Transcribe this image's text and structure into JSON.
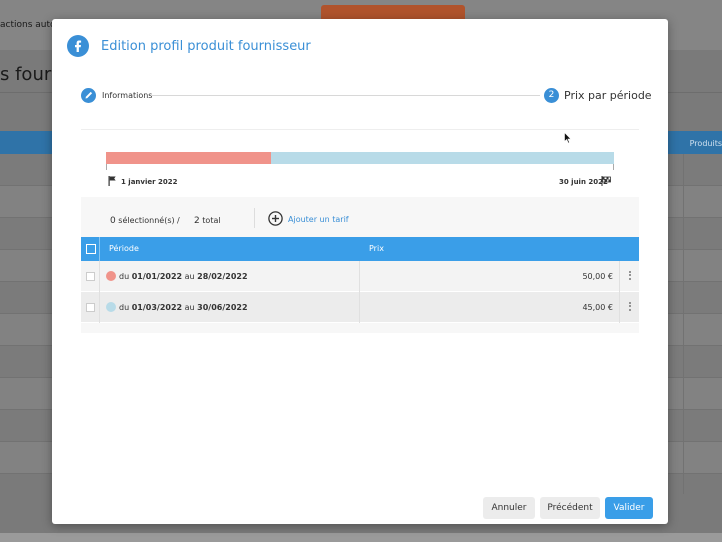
{
  "background": {
    "topbar_text": "actions autori",
    "page_title": "s fourn",
    "band_text": "Produits"
  },
  "modal": {
    "title": "Edition profil produit fournisseur",
    "stepper": {
      "step1_label": "Informations",
      "step2_number": "2",
      "step2_label": "Prix par période"
    },
    "timeline": {
      "start_label": "1 janvier 2022",
      "end_label": "30 juin 2022",
      "segments": [
        {
          "color": "#f0938a",
          "fraction": 0.325
        },
        {
          "color": "#b8dbe8",
          "fraction": 0.675
        }
      ]
    },
    "toolbar": {
      "selected_count": "0",
      "selected_label": "sélectionné(s)",
      "separator": "/",
      "total_count": "2",
      "total_label": "total",
      "add_label": "Ajouter un tarif"
    },
    "table": {
      "columns": {
        "periode": "Période",
        "prix": "Prix"
      },
      "rows": [
        {
          "du": "du",
          "start": "01/01/2022",
          "au": "au",
          "end": "28/02/2022",
          "price": "50,00 €",
          "color": "#f0938a"
        },
        {
          "du": "du",
          "start": "01/03/2022",
          "au": "au",
          "end": "30/06/2022",
          "price": "45,00 €",
          "color": "#b8dbe8"
        }
      ]
    },
    "buttons": {
      "cancel": "Annuler",
      "previous": "Précédent",
      "validate": "Valider"
    }
  },
  "colors": {
    "accent": "#3a8fd6",
    "header_blue": "#3a9ee8"
  }
}
